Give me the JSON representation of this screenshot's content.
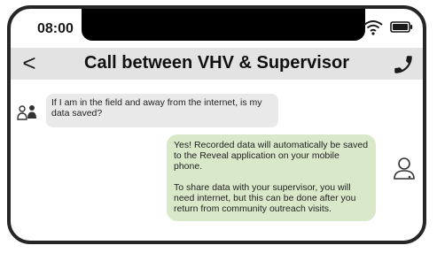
{
  "status_bar": {
    "time": "08:00",
    "icons": [
      "wifi-icon",
      "battery-icon"
    ]
  },
  "header": {
    "back_icon": "chevron-left-icon",
    "back_glyph": "<",
    "title": "Call between VHV & Supervisor",
    "call_icon": "phone-icon"
  },
  "messages": [
    {
      "sender": "vhv",
      "avatar_icon": "people-icon",
      "text": "If I am in the field and away from the internet, is my data saved?"
    },
    {
      "sender": "supervisor",
      "avatar_icon": "person-icon",
      "paragraphs": [
        "Yes! Recorded data will automatically be saved to the Reveal application on your mobile phone.",
        "To share data with your supervisor, you will need internet, but this can be done after you return from community outreach visits."
      ]
    }
  ],
  "colors": {
    "header_bg": "#e3e3e3",
    "incoming_bubble": "#e9e9ea",
    "outgoing_bubble": "#d9e8c9",
    "frame": "#262626"
  }
}
